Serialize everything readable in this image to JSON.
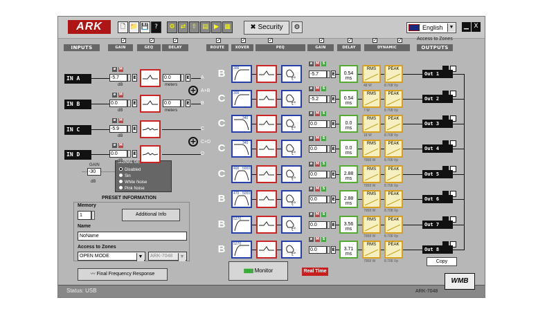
{
  "titlebar": {
    "logo": "ARK",
    "security_label": "Security",
    "language": "English",
    "minimize": "▁",
    "close": "X"
  },
  "toolbar": [
    "new",
    "open",
    "save",
    "help"
  ],
  "headers": {
    "inputs": "INPUTS",
    "gain": "GAIN",
    "geq": "GEQ",
    "delay": "DELAY",
    "route": "ROUTE",
    "xover": "XOVER",
    "peq": "PEQ",
    "gain2": "GAIN",
    "delay2": "DELAY",
    "dynamic": "DYNAMIC",
    "outputs": "OUTPUTS",
    "access_to_zones": "Access to Zones"
  },
  "inputs": [
    {
      "label": "IN A",
      "gain": "-5.7",
      "delay": "0.0",
      "bus": "A",
      "units": "dB",
      "delay_units": "meters"
    },
    {
      "label": "IN B",
      "gain": "0.0",
      "delay": "0.0",
      "bus": "B",
      "units": "dB",
      "delay_units": "meters"
    },
    {
      "label": "IN C",
      "gain": "-5.9",
      "bus": "C",
      "units": "dB"
    },
    {
      "label": "IN D",
      "gain": "0.0",
      "bus": "D",
      "units": "dB"
    }
  ],
  "bus_labels": {
    "ab": "A+B",
    "cd": "C+D",
    "m": "M",
    "e": "E"
  },
  "outputs": [
    {
      "route": "B",
      "xover_lo": "300",
      "xover_hi": "",
      "gain": "-5.7",
      "delay": "0.54",
      "delay_unit": "ms",
      "rms_level": "48 W",
      "peak_level": "8.708 Vp",
      "label": "Out 1"
    },
    {
      "route": "C",
      "xover_lo": "300",
      "xover_hi": "",
      "gain": "-5.2",
      "delay": "0.54",
      "delay_unit": "ms",
      "rms_level": "7 W",
      "peak_level": "8.708 Vp",
      "label": "Out 2"
    },
    {
      "route": "C",
      "xover_lo": "",
      "xover_hi": "340",
      "gain": "0.0",
      "delay": "0.0",
      "delay_unit": "ms",
      "rms_level": "18 W",
      "peak_level": "8.708 Vp",
      "label": "Out 3"
    },
    {
      "route": "C",
      "xover_lo": "",
      "xover_hi": "340",
      "gain": "0.0",
      "delay": "0.0",
      "delay_unit": "ms",
      "rms_level": "7958 W",
      "peak_level": "8.706 Vp",
      "label": "Out 4"
    },
    {
      "route": "C",
      "xover_lo": "400",
      "xover_hi": "5000",
      "gain": "0.0",
      "delay": "2.88",
      "delay_unit": "ms",
      "rms_level": "7958 W",
      "peak_level": "8.706 Vp",
      "label": "Out 5"
    },
    {
      "route": "B",
      "xover_lo": "470",
      "xover_hi": "5000",
      "gain": "0.0",
      "delay": "2.88",
      "delay_unit": "ms",
      "rms_level": "7958 W",
      "peak_level": "8.708 Vp",
      "label": "Out 6"
    },
    {
      "route": "B",
      "xover_lo": "5270",
      "xover_hi": "",
      "gain": "0.0",
      "delay": "3.56",
      "delay_unit": "ms",
      "rms_level": "7958 W",
      "peak_level": "8.706 Vp",
      "label": "Out 7"
    },
    {
      "route": "B",
      "xover_lo": "5270",
      "xover_hi": "",
      "gain": "0.0",
      "delay": "3.71",
      "delay_unit": "ms",
      "rms_level": "7958 W",
      "peak_level": "8.706 Vp",
      "label": "Out 8"
    }
  ],
  "block_labels": {
    "rms": "RMS",
    "peak": "PEAK"
  },
  "signal_generator": {
    "title": "SIGNAL GENERATOR",
    "gain_label": "GAIN",
    "gain_value": "-30",
    "gain_units": "dB",
    "options": [
      "Disabled",
      "Sin",
      "White Noise",
      "Pink Noise"
    ],
    "selected": "Disabled"
  },
  "preset": {
    "title": "PRESET INFORMATION",
    "memory_label": "Memory",
    "memory_value": "1",
    "additional_info": "Additional Info",
    "name_label": "Name",
    "name_value": "NoName",
    "access_label": "Access to Zones",
    "access_mode": "OPEN MODE",
    "device": "ARK-7048"
  },
  "buttons": {
    "final_response": "Final Frequency Response",
    "monitor": "Monitor",
    "real_time": "Real Time",
    "copy": "Copy"
  },
  "status": {
    "text": "Status:  USB",
    "device": "ARK-7048",
    "brand": "WMB"
  },
  "colors": {
    "peq_border": "#c22222",
    "xover_border": "#2540a8",
    "delay_border": "#55aa33",
    "dynamic_border": "#d9a020",
    "realtime_bg": "#c81e1e"
  }
}
